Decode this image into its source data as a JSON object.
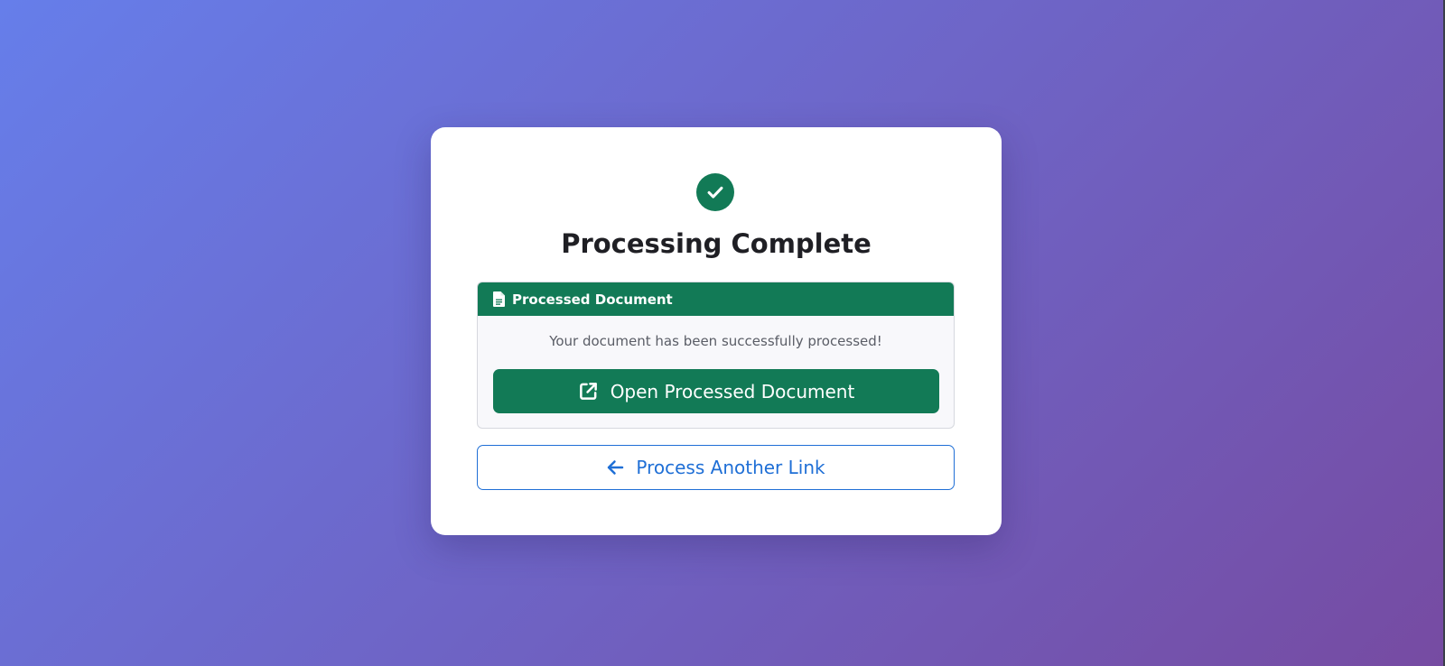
{
  "title": "Processing Complete",
  "icons": {
    "status": "check-circle-icon",
    "document": "file-document-icon",
    "open": "external-link-icon",
    "back": "arrow-left-icon"
  },
  "document_panel": {
    "header_label": "Processed Document",
    "message": "Your document has been successfully processed!",
    "open_button_label": "Open Processed Document"
  },
  "back_button_label": "Process Another Link",
  "colors": {
    "background_gradient_start": "#667eea",
    "background_gradient_end": "#764ba2",
    "success_green": "#127a56",
    "link_blue": "#1f6fd6",
    "card_background": "#ffffff"
  }
}
